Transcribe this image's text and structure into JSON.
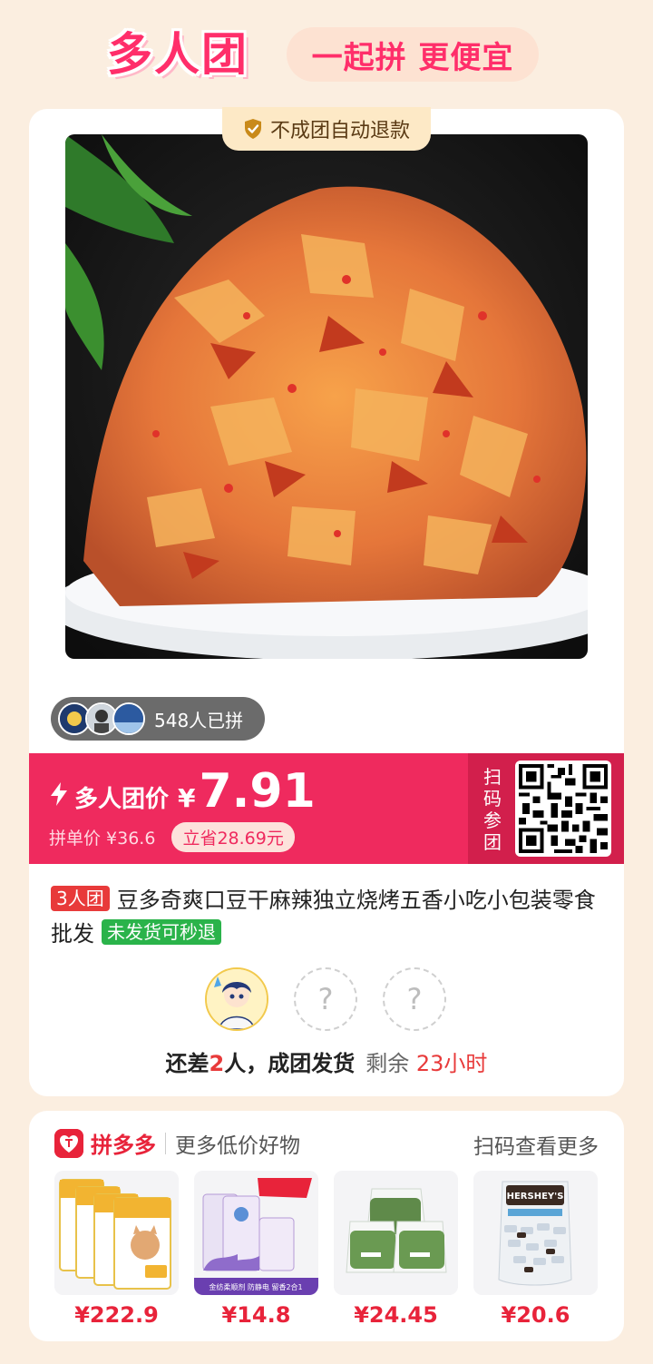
{
  "header": {
    "brand": "多人团",
    "slogan": "一起拼 更便宜"
  },
  "card": {
    "refund_tag": "不成团自动退款",
    "joined_count": "548人已拼"
  },
  "price": {
    "label": "多人团价",
    "currency": "¥",
    "value": "7.91",
    "single_label": "拼单价 ¥36.6",
    "save": "立省28.69元",
    "scan_label": "扫码参团"
  },
  "product": {
    "team_badge": "3人团",
    "title": "豆多奇爽口豆干麻辣独立烧烤五香小吃小包装零食批发",
    "refund_badge": "未发货可秒退"
  },
  "group": {
    "empty_slot": "?",
    "prefix": "还差",
    "count": "2",
    "suffix": "人，成团发货",
    "remain_label": "剩余",
    "remain_time": "23小时"
  },
  "recommend": {
    "brand": "拼多多",
    "subtitle": "更多低价好物",
    "scan_more": "扫码查看更多",
    "items": [
      {
        "price": "¥222.9",
        "image": "cat-food"
      },
      {
        "price": "¥14.8",
        "image": "softener"
      },
      {
        "price": "¥24.45",
        "image": "cotton-towels"
      },
      {
        "price": "¥20.6",
        "image": "chocolate",
        "label": "HERSHEY'S"
      }
    ],
    "softener_caption": "金纺柔顺剂 防静电 留香2合1"
  },
  "colors": {
    "accent": "#ef2a5e",
    "pdd_red": "#e8233a",
    "background": "#fbeee0"
  }
}
